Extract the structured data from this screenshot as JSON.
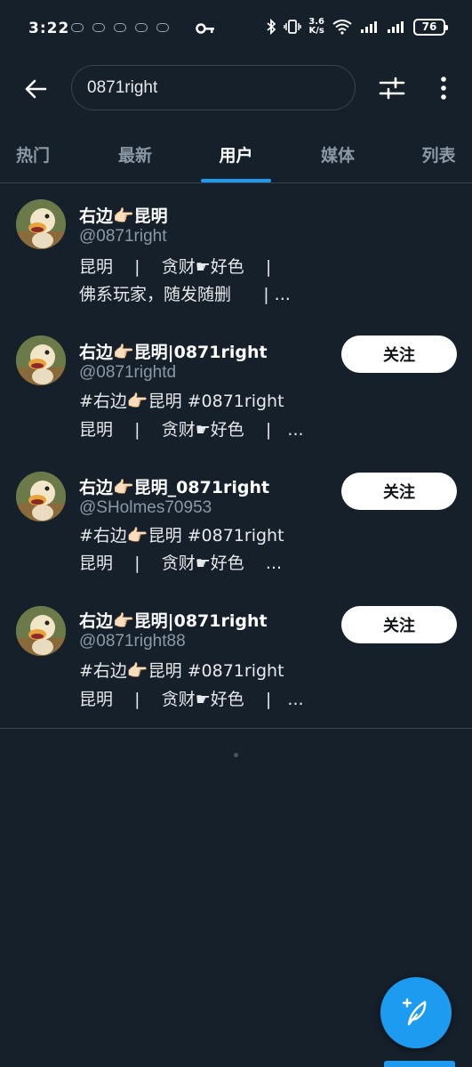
{
  "status_bar": {
    "time": "3:22",
    "net_speed_value": "3.6",
    "net_speed_unit": "K/s",
    "battery": "76"
  },
  "search": {
    "query": "0871right"
  },
  "tabs": [
    {
      "label": "热门"
    },
    {
      "label": "最新"
    },
    {
      "label": "用户"
    },
    {
      "label": "媒体"
    },
    {
      "label": "列表"
    }
  ],
  "active_tab": "用户",
  "users": [
    {
      "name": "右边👉🏻昆明",
      "handle": "@0871right",
      "bio_line1": "昆明    |    贪财☛好色    |",
      "bio_line2": "佛系玩家，随发随删      | ...",
      "follow_label": ""
    },
    {
      "name": "右边👉🏻昆明|0871right",
      "handle": "@0871rightd",
      "bio_line1": "#右边👉🏻昆明 #0871right",
      "bio_line2": "昆明    |    贪财☛好色    |   ...",
      "follow_label": "关注"
    },
    {
      "name": "右边👉🏻昆明_0871right",
      "handle": "@SHolmes70953",
      "bio_line1": "#右边👉🏻昆明 #0871right",
      "bio_line2": "昆明    |    贪财☛好色    ...",
      "follow_label": "关注"
    },
    {
      "name": "右边👉🏻昆明|0871right",
      "handle": "@0871right88",
      "bio_line1": "#右边👉🏻昆明 #0871right",
      "bio_line2": "昆明    |    贪财☛好色    |   ...",
      "follow_label": "关注"
    }
  ],
  "colors": {
    "background": "#15202b",
    "accent": "#1d9bf0",
    "muted_text": "#8b98a5",
    "divider": "#38444d"
  },
  "icons": {
    "back": "arrow-left-icon",
    "filter": "sliders-icon",
    "more": "more-vertical-icon",
    "compose": "feather-plus-icon"
  }
}
